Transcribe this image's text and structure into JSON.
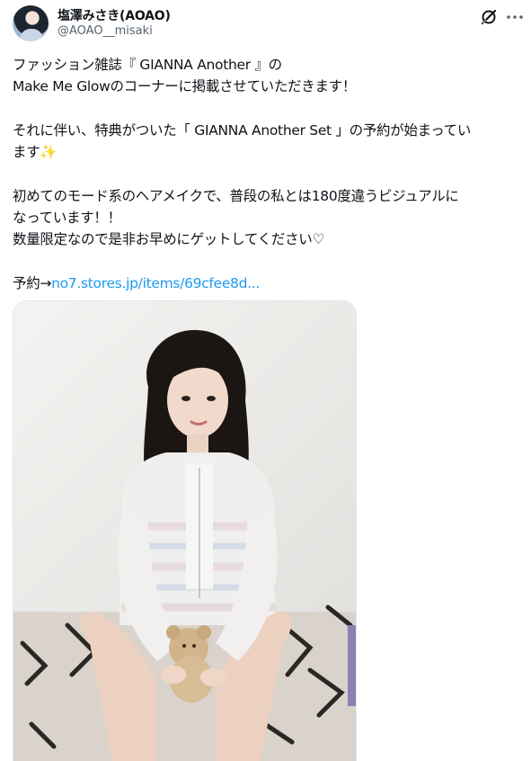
{
  "user": {
    "display_name": "塩澤みさき(AOAO)",
    "handle": "@AOAO__misaki",
    "avatar_icon": "profile-avatar",
    "grok_icon": "grok-icon",
    "more_icon": "more-options-icon"
  },
  "tweet": {
    "line1": "ファッション雑誌『 GIANNA Another 』の",
    "line2": "Make Me Glowのコーナーに掲載させていただきます！",
    "line3": "それに伴い、特典がついた「 GIANNA Another Set 」の予約が始まってい",
    "line4_text": "ます",
    "line4_emoji": "✨",
    "line5": "初めてのモード系のヘアメイクで、普段の私とは180度違うビジュアルに",
    "line6": "なっています！！",
    "line7": "数量限定なので是非お早めにゲットしてください♡",
    "reserve_prefix": "予約→",
    "reserve_link": "no7.stores.jp/items/69cfee8d..."
  },
  "colors": {
    "text": "#0f1419",
    "secondary": "#536471",
    "link": "#1d9bf0"
  }
}
